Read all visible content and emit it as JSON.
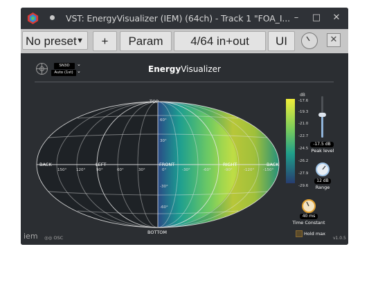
{
  "window": {
    "title": "VST: EnergyVisualizer (IEM) (64ch) - Track 1 \"FOA_I...",
    "buttons": {
      "minimize": "–",
      "maximize": "□",
      "close": "✕"
    }
  },
  "toolbar": {
    "preset_label": "No preset",
    "add_label": "+",
    "param_label": "Param",
    "io_label": "4/64 in+out",
    "ui_label": "UI",
    "close_label": "✕"
  },
  "plugin": {
    "title_bold": "Energy",
    "title_rest": "Visualizer",
    "normalization": "SN3D",
    "order": "Auto (1st)",
    "footer_logo": "iem",
    "footer_osc": "OSC",
    "version": "v1.0.5"
  },
  "map": {
    "top_label": "TOP",
    "bottom_label": "BOTTOM",
    "front_label": "FRONT",
    "left_label": "LEFT",
    "right_label": "RIGHT",
    "back_left_label": "BACK",
    "back_right_label": "BACK",
    "az_labels": [
      "150°",
      "120°",
      "90°",
      "60°",
      "30°",
      "0°",
      "-30°",
      "-60°",
      "-90°",
      "-120°",
      "-150°"
    ],
    "el_labels": [
      "60°",
      "30°",
      "-30°",
      "-60°"
    ]
  },
  "colorbar": {
    "unit": "dB",
    "ticks": [
      "-17.6",
      "-19.3",
      "-21.0",
      "-22.7",
      "-24.5",
      "-26.2",
      "-27.9",
      "-29.6"
    ],
    "top_color": "#f0ee3a",
    "bottom_color": "#273d70"
  },
  "controls": {
    "peak_level_value": "-17.5 dB",
    "peak_level_label": "Peak level",
    "peak_level_fraction": 0.55,
    "range_value": "12 dB",
    "range_label": "Range",
    "time_constant_value": "40 ms",
    "time_constant_label": "Time Constant",
    "hold_max_label": "Hold max",
    "hold_max_checked": false
  },
  "colors": {
    "background": "#2b2e32",
    "accent": "#e0a030",
    "toolbar": "#c7c7c7"
  }
}
